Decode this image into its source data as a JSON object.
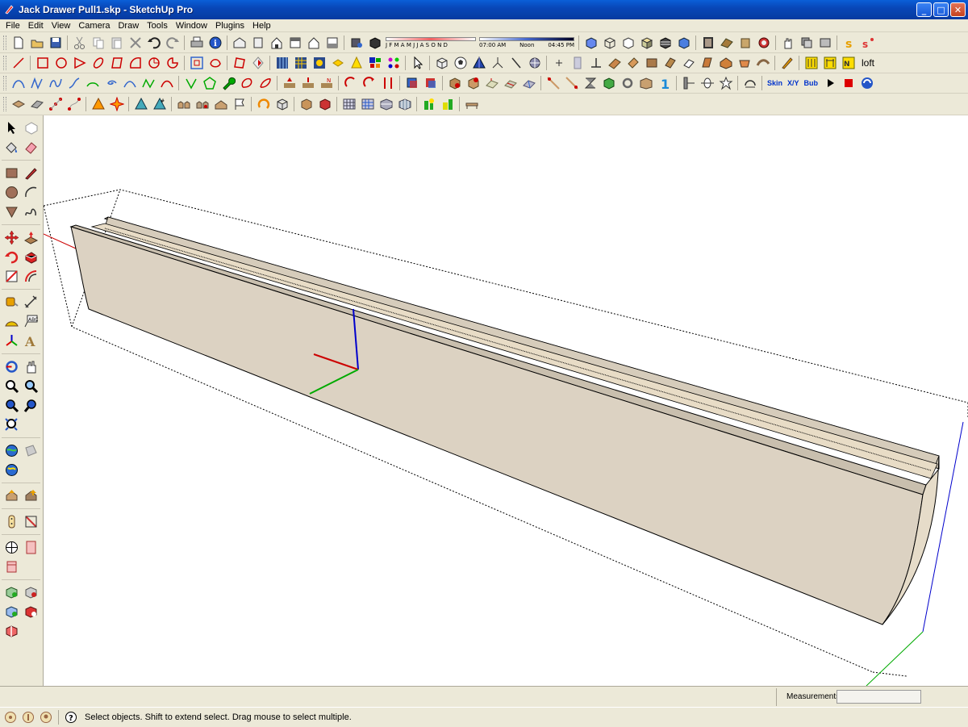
{
  "window": {
    "title": "Jack Drawer Pull1.skp - SketchUp Pro",
    "minimize": "_",
    "maximize": "□",
    "close": "✕"
  },
  "menu": [
    "File",
    "Edit",
    "View",
    "Camera",
    "Draw",
    "Tools",
    "Window",
    "Plugins",
    "Help"
  ],
  "shadow": {
    "months": "J F M A M J J A S O N D",
    "time_start": "07:00 AM",
    "time_noon": "Noon",
    "time_end": "04:45 PM"
  },
  "toolbar": {
    "loft": "loft",
    "skin": "Skin",
    "xyz": "X/Y",
    "bub": "Bub"
  },
  "measurements": {
    "label": "Measurements",
    "value": ""
  },
  "status": {
    "message": "Select objects. Shift to extend select. Drag mouse to select multiple."
  },
  "colors": {
    "model_face": "#dcd2c2",
    "model_top": "#c9bfae",
    "axis_red": "#cc0000",
    "axis_green": "#00aa00",
    "axis_blue": "#0000cc"
  }
}
